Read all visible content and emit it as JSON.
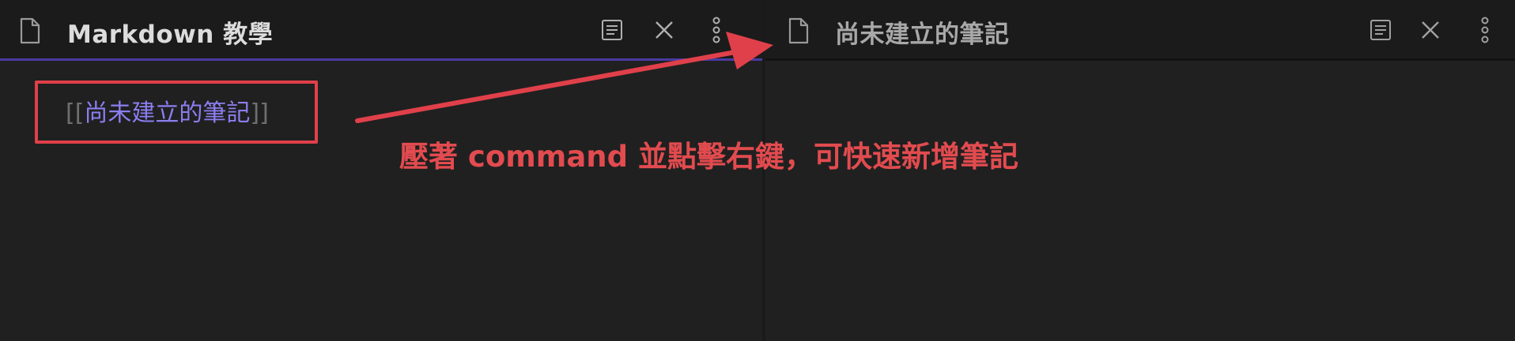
{
  "left_pane": {
    "title": "Markdown 教學",
    "link": {
      "open_brackets": "[[",
      "text": "尚未建立的筆記",
      "close_brackets": "]]"
    }
  },
  "right_pane": {
    "title": "尚未建立的筆記"
  },
  "annotation": {
    "text": "壓著 command 並點擊右鍵，可快速新增筆記",
    "color": "#e24b4f"
  },
  "icons": {
    "file": "file-icon",
    "reading_view": "reading-view-icon",
    "close": "close-icon",
    "more": "more-options-icon"
  },
  "colors": {
    "background": "#202020",
    "header": "#1b1b1b",
    "accent": "#4a3aa3",
    "link": "#8b7ef0"
  }
}
